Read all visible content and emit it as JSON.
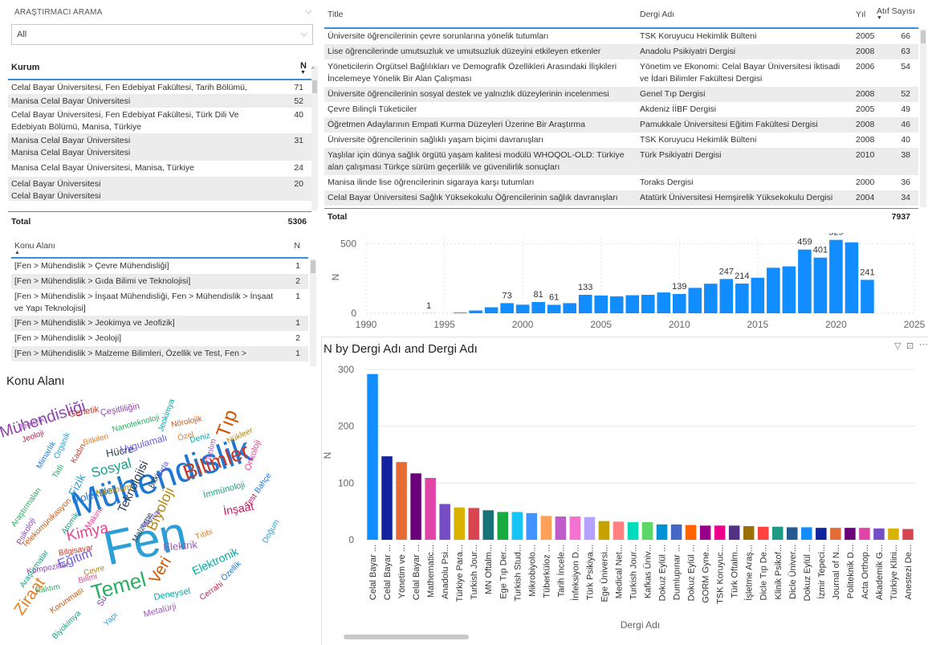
{
  "researcher_slicer": {
    "title": "ARAŞTIRMACI ARAMA",
    "value": "All"
  },
  "kurum_table": {
    "col_name": "Kurum",
    "col_n": "N",
    "rows": [
      {
        "name": "Celal Bayar Üniversitesi, Fen Edebiyat Fakültesi, Tarih Bölümü, Manisa, Türkiye",
        "n": "71"
      },
      {
        "name": "Manisa Celal Bayar Üniversitesi",
        "n": "52"
      },
      {
        "name": "Celal Bayar Üniversitesi, Fen Edebiyat Fakültesi, Türk Dili Ve Edebiyatı Bölümü, Manisa, Türkiye",
        "n": "40"
      },
      {
        "name": "Manisa Celal Bayar Üniversitesi\nManisa Celal Bayar Üniversitesi",
        "n": "31"
      },
      {
        "name": "Manisa Celal Bayar Üniversitesi, Manisa, Türkiye",
        "n": "24"
      },
      {
        "name": "Celal Bayar Üniversitesi\nCelal Bayar Üniversitesi",
        "n": "20"
      }
    ],
    "total_label": "Total",
    "total": "5306"
  },
  "articles_table": {
    "col_title": "Title",
    "col_journal": "Dergi Adı",
    "col_year": "Yıl",
    "col_cites": "Atıf Sayısı",
    "rows": [
      {
        "title": "Üniversite öğrencilerinin çevre sorunlarına yönelik tutumları",
        "journal": "TSK Koruyucu Hekimlik Bülteni",
        "year": "2005",
        "cites": "66"
      },
      {
        "title": "Lise öğrencilerinde umutsuzluk ve umutsuzluk düzeyini etkileyen etkenler",
        "journal": "Anadolu Psikiyatri Dergisi",
        "year": "2008",
        "cites": "63"
      },
      {
        "title": "Yöneticilerin Örgütsel Bağlılıkları ve Demografik Özellikleri Arasındaki İlişkileri İncelemeye Yönelik Bir Alan Çalışması",
        "journal": "Yönetim ve Ekonomi: Celal Bayar Üniversitesi İktisadi ve İdari Bilimler Fakültesi Dergisi",
        "year": "2006",
        "cites": "54"
      },
      {
        "title": "Üniversite öğrencilerinin sosyal destek ve yalnızlık düzeylerinin incelenmesi",
        "journal": "Genel Tıp Dergisi",
        "year": "2008",
        "cites": "52"
      },
      {
        "title": "Çevre Bilinçli Tüketiciler",
        "journal": "Akdeniz İİBF Dergisi",
        "year": "2005",
        "cites": "49"
      },
      {
        "title": "Öğretmen Adaylarının Empati Kurma Düzeyleri Üzerine Bir Araştırma",
        "journal": "Pamukkale Üniversitesi Eğitim Fakültesi Dergisi",
        "year": "2008",
        "cites": "46"
      },
      {
        "title": "Üniversite öğrencilerinin sağlıklı yaşam biçimi davranışları",
        "journal": "TSK Koruyucu Hekimlik Bülteni",
        "year": "2008",
        "cites": "40"
      },
      {
        "title": "Yaşlılar için dünya sağlık örgütü yaşam kalitesi modülü WHOQOL-OLD: Türkiye alan çalışması Türkçe sürüm geçerlilik ve güvenilirlik sonuçları",
        "journal": "Türk Psikiyatri Dergisi",
        "year": "2010",
        "cites": "38"
      },
      {
        "title": "Manisa ilinde lise öğrencilerinin sigaraya karşı tutumları",
        "journal": "Toraks Dergisi",
        "year": "2000",
        "cites": "36"
      },
      {
        "title": "Celal Bayar Üniversitesi Sağlık Yüksekokulu Öğrencilerinin sağlık davranışları",
        "journal": "Atatürk Üniversitesi Hemşirelik Yüksekokulu Dergisi",
        "year": "2004",
        "cites": "34"
      }
    ],
    "total_label": "Total",
    "total": "7937"
  },
  "konu_table": {
    "col_name": "Konu Alanı",
    "col_n": "N",
    "rows": [
      {
        "name": "[Fen > Mühendislik > Çevre Mühendisliği]",
        "n": "1"
      },
      {
        "name": "[Fen > Mühendislik > Gıda Bilimi ve Teknolojisi]",
        "n": "2"
      },
      {
        "name": "[Fen > Mühendislik > İnşaat Mühendisliği, Fen > Mühendislik > İnşaat ve Yapı Teknolojisi]",
        "n": "1"
      },
      {
        "name": "[Fen > Mühendislik > Jeokimya ve Jeofizik]",
        "n": "1"
      },
      {
        "name": "[Fen > Mühendislik > Jeoloji]",
        "n": "2"
      },
      {
        "name": "[Fen > Mühendislik > Malzeme Bilimleri, Özellik ve Test, Fen > Mühendislik >",
        "n": "1"
      }
    ]
  },
  "wordcloud": {
    "title": "Konu Alanı",
    "words": [
      "Mühendislik",
      "Fen",
      "Bilimler",
      "Mühendisliği",
      "Temel",
      "Tıp",
      "Sosyal",
      "Kimya",
      "Biyoloji",
      "Teknolojisi",
      "Eğitim",
      "Ziraat",
      "Elektronik",
      "Elektrik",
      "İnşaat",
      "Moleküler",
      "Fizik",
      "Genetik",
      "Çeşitliliğin",
      "Nanoteknoloji",
      "Nörolojik",
      "İmmünoloji",
      "Onkoloji",
      "Nükleer",
      "Hücre",
      "Uygulamalı",
      "Bitkileri",
      "Jeokimya",
      "Jeofizik",
      "Jeoloji",
      "Mimarlık",
      "Organik",
      "Kadın",
      "Psikoloji",
      "Araştırmaları",
      "Telekomünikasyon",
      "Atomik",
      "Makine",
      "Nanobilim",
      "Bitki",
      "Gıda",
      "Özel",
      "Deniz",
      "Yazılım",
      "Test",
      "Bahçe",
      "Doğum",
      "Bilgisayar",
      "Kompozitler",
      "Kalıtım",
      "Korunması",
      "Biyokimya",
      "Bilimi",
      "Çevre",
      "Malzeme",
      "Mantar",
      "Tıbbi",
      "Deneysel",
      "Metalürji",
      "Cerrahi",
      "Özellik",
      "Yapı",
      "Hastalıkları",
      "Su",
      "Tatlı",
      "Veri",
      "Araştırmalar"
    ]
  },
  "year_chart": {
    "chart_data": {
      "type": "bar",
      "ylabel": "N",
      "x": [
        1994,
        1996,
        1997,
        1998,
        1999,
        2000,
        2001,
        2002,
        2003,
        2004,
        2005,
        2006,
        2007,
        2008,
        2009,
        2010,
        2011,
        2012,
        2013,
        2014,
        2015,
        2016,
        2017,
        2018,
        2019,
        2020,
        2021,
        2022
      ],
      "values": [
        1,
        5,
        20,
        43,
        73,
        62,
        81,
        61,
        73,
        133,
        128,
        122,
        130,
        133,
        150,
        139,
        183,
        213,
        247,
        214,
        256,
        328,
        338,
        459,
        401,
        529,
        511,
        241
      ],
      "data_labels": [
        1,
        null,
        null,
        null,
        73,
        null,
        81,
        61,
        null,
        133,
        null,
        null,
        null,
        null,
        null,
        139,
        null,
        null,
        247,
        214,
        null,
        null,
        null,
        459,
        401,
        529,
        null,
        241
      ],
      "xlim": [
        1990,
        2025
      ],
      "ylim": [
        0,
        550
      ],
      "xticks": [
        1990,
        1995,
        2000,
        2005,
        2010,
        2015,
        2020,
        2025
      ],
      "yticks": [
        0,
        500
      ]
    }
  },
  "journal_chart": {
    "title": "N by Dergi Adı and Dergi Adı",
    "chart_data": {
      "type": "bar",
      "xlabel": "Dergi Adı",
      "ylabel": "N",
      "categories": [
        "Celal Bayar ...",
        "Celal Bayar ...",
        "Yönetim ve ...",
        "Celal Bayar ...",
        "Mathematic...",
        "Anadolu Psi...",
        "Türkiye Para...",
        "Turkish Jour...",
        "MN Oftalm...",
        "Ege Tıp Der...",
        "Turkish Stud...",
        "Mikrobiyolo...",
        "Tüberküloz ...",
        "Tarih İncele...",
        "İnfeksiyon D...",
        "Türk Psikiya...",
        "Ege Üniversi...",
        "Medical Net...",
        "Turkish Jour...",
        "Kafkas Üniv...",
        "Dokuz Eylül ...",
        "Dumlupınar ...",
        "Dokuz Eylül ...",
        "GORM Gyne...",
        "TSK Koruyuc...",
        "Türk Oftalm...",
        "İşletme Araş...",
        "Dicle Tıp De...",
        "Klinik Psikof...",
        "Dicle Üniver...",
        "Dokuz Eylül ...",
        "İzmir Tepeci...",
        "Journal of N...",
        "Politeknik D...",
        "Acta Orthop...",
        "Akademik G...",
        "Türkiye Klini...",
        "Anestezi De..."
      ],
      "values": [
        292,
        147,
        137,
        117,
        109,
        63,
        57,
        56,
        52,
        49,
        49,
        47,
        42,
        41,
        41,
        40,
        33,
        32,
        31,
        31,
        27,
        27,
        26,
        25,
        25,
        25,
        24,
        23,
        23,
        22,
        22,
        21,
        21,
        21,
        21,
        20,
        20,
        19
      ],
      "ylim": [
        0,
        300
      ],
      "yticks": [
        0,
        100,
        200,
        300
      ]
    },
    "colors": [
      "#118DFF",
      "#12239E",
      "#E66C37",
      "#6B007B",
      "#E044A7",
      "#744EC2",
      "#D9B300",
      "#D64550",
      "#197278",
      "#1AAB40",
      "#15C6F4",
      "#4092FF",
      "#FFA058",
      "#BE5DC9",
      "#F472D0",
      "#B5A1FF",
      "#C4A200",
      "#FF8080",
      "#00DBBC",
      "#5BD667",
      "#0091D5",
      "#4668C5",
      "#FF6300",
      "#99008A",
      "#EC008C",
      "#533285",
      "#99700A",
      "#FF4141",
      "#1F9A85",
      "#255A91",
      "#118DFF",
      "#12239E",
      "#E66C37",
      "#6B007B",
      "#E044A7",
      "#744EC2",
      "#D9B300",
      "#D64550"
    ],
    "filter_icon": "filter-icon",
    "focus_icon": "focus-mode-icon",
    "more_icon": "more-options-icon"
  }
}
